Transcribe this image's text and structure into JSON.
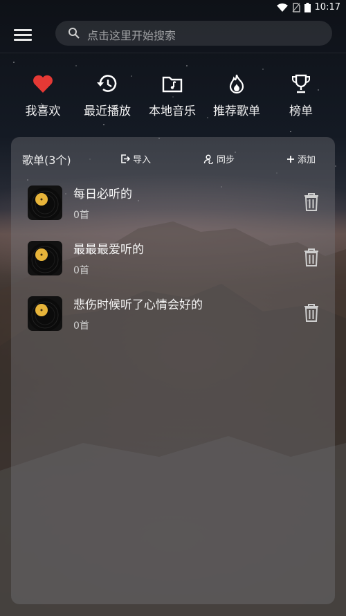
{
  "status_bar": {
    "time": "10:17"
  },
  "search": {
    "placeholder": "点击这里开始搜索"
  },
  "quick_nav": [
    {
      "label": "我喜欢",
      "icon": "heart-icon",
      "color": "#e53935"
    },
    {
      "label": "最近播放",
      "icon": "history-icon"
    },
    {
      "label": "本地音乐",
      "icon": "folder-music-icon"
    },
    {
      "label": "推荐歌单",
      "icon": "flame-icon"
    },
    {
      "label": "榜单",
      "icon": "trophy-icon"
    }
  ],
  "playlists_panel": {
    "title": "歌单(3个)",
    "actions": {
      "import": "导入",
      "sync": "同步",
      "add": "添加"
    },
    "items": [
      {
        "title": "每日必听的",
        "count": "0首"
      },
      {
        "title": "最最最爱听的",
        "count": "0首"
      },
      {
        "title": "悲伤时候听了心情会好的",
        "count": "0首"
      }
    ]
  }
}
